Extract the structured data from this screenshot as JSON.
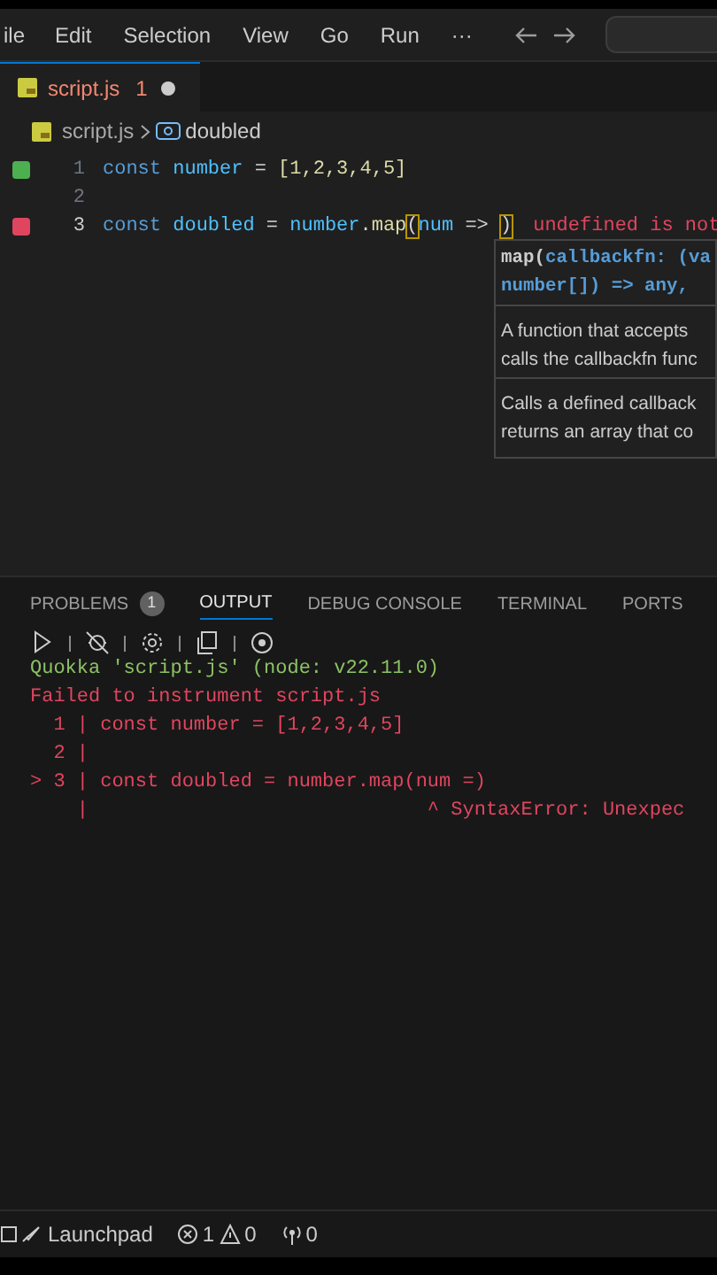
{
  "menu_bar": {
    "items": [
      "ile",
      "Edit",
      "Selection",
      "View",
      "Go",
      "Run",
      "···"
    ]
  },
  "tabs": [
    {
      "label": "script.js",
      "problems": "1",
      "modified": true,
      "has_error": true,
      "selected": true
    }
  ],
  "breadcrumbs": {
    "file": "script.js",
    "symbol": "doubled"
  },
  "editor": {
    "lines": [
      {
        "number": "1",
        "color": "#4caf50",
        "current": false,
        "tokens": [
          {
            "kind": "keyword",
            "text": "const"
          },
          {
            "kind": "variable",
            "text": " number"
          },
          {
            "kind": "operator",
            "text": " = "
          },
          {
            "kind": "bracket",
            "text": "[1,2,3,4,5]"
          }
        ]
      },
      {
        "number": "2",
        "current": false
      },
      {
        "number": "3",
        "color": "#e0455f",
        "current": true,
        "tokens": [
          {
            "kind": "keyword",
            "text": "const"
          },
          {
            "kind": "variable",
            "text": " doubled"
          },
          {
            "kind": "operator",
            "text": " = "
          },
          {
            "kind": "variable",
            "text": "number"
          },
          {
            "kind": "operator",
            "text": "."
          },
          {
            "kind": "function",
            "text": "map"
          },
          {
            "kind": "match",
            "text": "("
          },
          {
            "kind": "variable",
            "text": "num"
          },
          {
            "kind": "operator",
            "text": " => "
          },
          {
            "kind": "match",
            "text": ")"
          }
        ],
        "inline_error": "undefined is not"
      }
    ]
  },
  "hover": {
    "signature": [
      [
        {
          "kind": "plain",
          "text": "map("
        },
        {
          "kind": "param",
          "text": "callbackfn: (va"
        }
      ],
      [
        {
          "kind": "param",
          "text": "number[]) => any,"
        }
      ]
    ],
    "docs": [
      [
        "A function that accepts",
        "calls the callbackfn func"
      ],
      [
        "Calls a defined callback",
        "returns an array that co"
      ]
    ]
  },
  "panel": {
    "tabs": [
      {
        "label": "PROBLEMS",
        "badge": "1",
        "selected": false
      },
      {
        "label": "OUTPUT",
        "selected": true
      },
      {
        "label": "DEBUG CONSOLE",
        "selected": false
      },
      {
        "label": "TERMINAL",
        "selected": false
      },
      {
        "label": "PORTS",
        "selected": false
      }
    ],
    "output": [
      {
        "kind": "info",
        "text": "Quokka 'script.js' (node: v22.11.0)"
      },
      {
        "kind": "error",
        "text": "Failed to instrument script.js"
      },
      {
        "kind": "error",
        "text": "  1 | const number = [1,2,3,4,5]"
      },
      {
        "kind": "error",
        "text": "  2 |"
      },
      {
        "kind": "error",
        "text": "> 3 | const doubled = number.map(num =)"
      },
      {
        "kind": "error",
        "text": "    |                             ^ SyntaxError: Unexpec"
      }
    ]
  },
  "status_bar": {
    "launchpad": "Launchpad",
    "errors": "1",
    "warnings": "0",
    "ports": "0"
  }
}
